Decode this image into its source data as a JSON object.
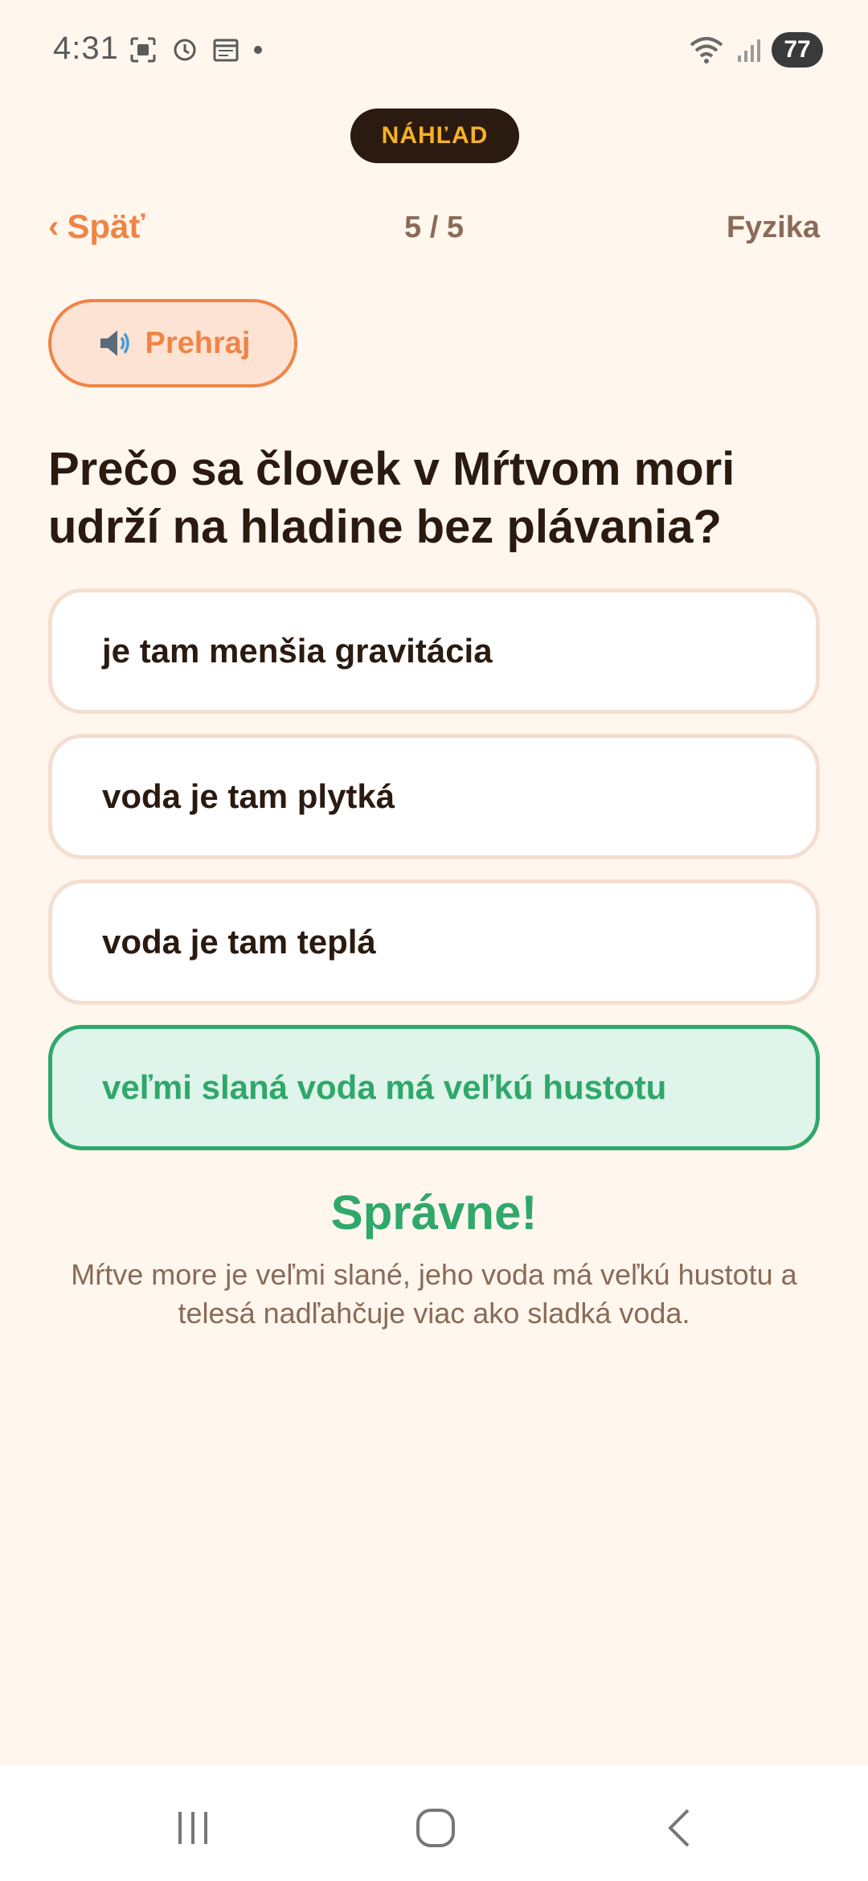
{
  "status_bar": {
    "time": "4:31",
    "battery": "77",
    "icons": [
      "screenshot-icon",
      "alarm-icon",
      "calendar-icon",
      "notification-dot",
      "wifi-icon",
      "signal-icon"
    ]
  },
  "preview_label": "NÁHĽAD",
  "nav": {
    "back_label": "Späť",
    "progress": "5 / 5",
    "subject": "Fyzika"
  },
  "play_button": {
    "icon": "speaker-icon",
    "label": "Prehraj"
  },
  "question": "Prečo sa človek v Mŕtvom mori udrží na hladine bez plávania?",
  "answers": [
    {
      "label": "je tam menšia gravitácia",
      "state": "neutral"
    },
    {
      "label": "voda je tam plytká",
      "state": "neutral"
    },
    {
      "label": "voda je tam teplá",
      "state": "neutral"
    },
    {
      "label": "veľmi slaná voda má veľkú hustotu",
      "state": "correct"
    }
  ],
  "feedback": {
    "title": "Správne!",
    "explanation": "Mŕtve more je veľmi slané, jeho voda má veľkú hustotu a telesá nadľahčuje viac ako sladká voda."
  },
  "colors": {
    "background": "#FFF7EE",
    "accent": "#F08446",
    "correct": "#2FA86A",
    "preview_text": "#F5B224",
    "text_dark": "#2B1A10",
    "text_muted": "#8A6A58"
  },
  "system_nav": [
    "recents-icon",
    "home-icon",
    "back-icon"
  ]
}
